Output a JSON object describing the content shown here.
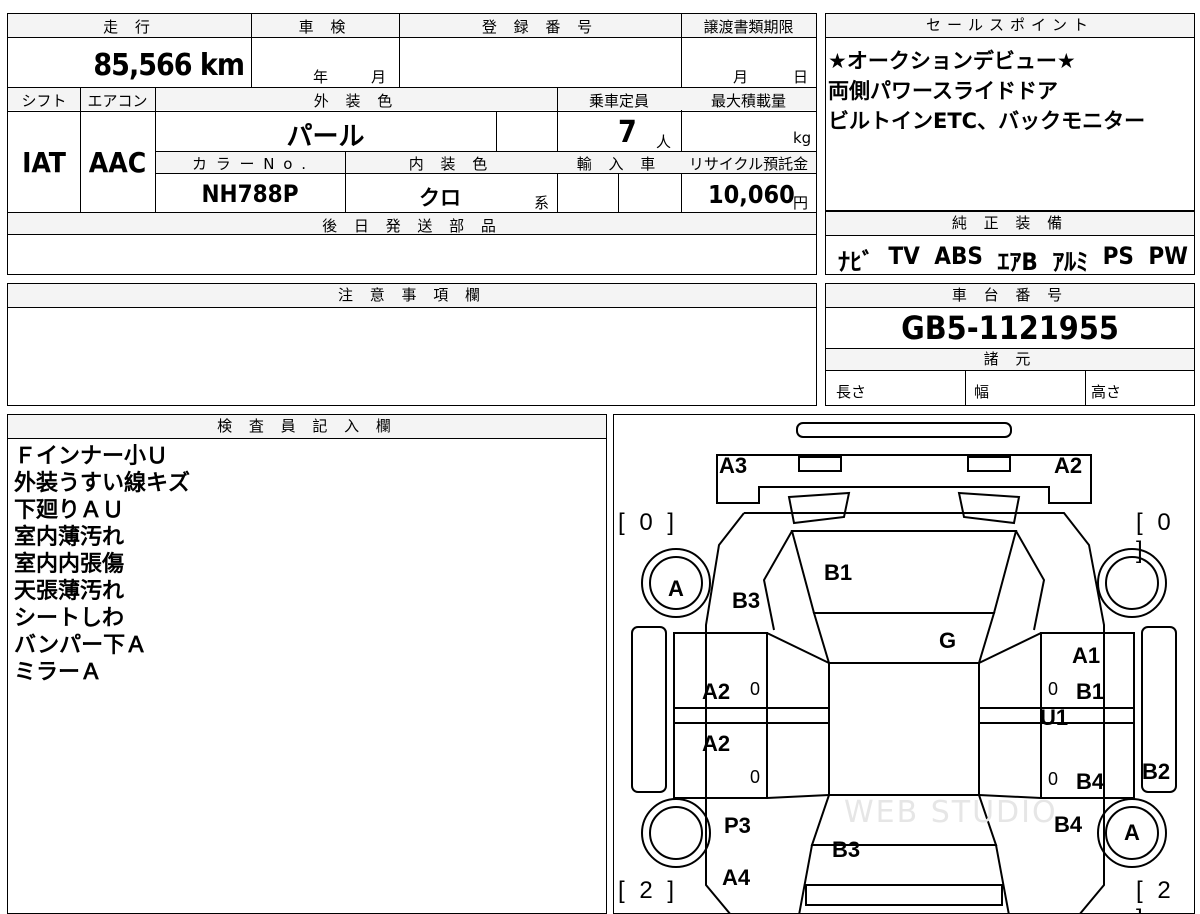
{
  "top": {
    "mileage_label": "走 行",
    "mileage": "85,566 km",
    "inspection_label": "車 検",
    "year_unit": "年",
    "month_unit": "月",
    "registration_label": "登 録 番 号",
    "transfer_label": "譲渡書類期限",
    "transfer_month": "月",
    "transfer_day": "日",
    "shift_label": "シフト",
    "shift": "IAT",
    "aircon_label": "エアコン",
    "aircon": "AAC",
    "exterior_color_label": "外 装 色",
    "exterior_color": "パール",
    "capacity_label": "乗車定員",
    "capacity": "7",
    "capacity_unit": "人",
    "max_load_label": "最大積載量",
    "max_load_unit": "kg",
    "color_no_label": "カ ラ ー N o .",
    "color_no": "NH788P",
    "interior_color_label": "内 装 色",
    "interior_color": "クロ",
    "interior_suffix": "系",
    "import_label": "輸 入 車",
    "recycle_label": "リサイクル預託金",
    "recycle_amount": "10,060",
    "recycle_unit": "円",
    "later_parts_label": "後 日 発 送 部 品"
  },
  "sales_point": {
    "label": "セールスポイント",
    "lines": [
      "★オークションデビュー★",
      "両側パワースライドドア",
      "ビルトインETC、バックモニター"
    ]
  },
  "equipment": {
    "label": "純 正 装 備",
    "items": [
      "ﾅﾋﾞ",
      "TV",
      "ABS",
      "ｴｱB",
      "ｱﾙﾐ",
      "PS",
      "PW"
    ]
  },
  "notes": {
    "label": "注 意 事 項 欄"
  },
  "chassis": {
    "label": "車 台 番 号",
    "number": "GB5-1121955",
    "specs_label": "諸 元",
    "length_label": "長さ",
    "width_label": "幅",
    "height_label": "高さ"
  },
  "inspector": {
    "label": "検 査 員 記 入 欄",
    "lines": [
      "Ｆインナー小Ｕ",
      "外装うすい線キズ",
      "下廻りＡＵ",
      "室内薄汚れ",
      "室内内張傷",
      "天張薄汚れ",
      "シートしわ",
      "バンパー下Ａ",
      "ミラーＡ"
    ]
  },
  "diagram": {
    "labels": {
      "A3": "A3",
      "A2_top": "A2",
      "B1_roof": "B1",
      "B3_top": "B3",
      "G": "G",
      "A1": "A1",
      "A2_left1": "A2",
      "A2_left2": "A2",
      "B1_right": "B1",
      "U1": "U1",
      "B4_right": "B4",
      "B2": "B2",
      "P3": "P3",
      "B4_low": "B4",
      "B3_bottom": "B3",
      "A4": "A4",
      "tire_fl": "A",
      "tire_rr": "A"
    },
    "brackets": {
      "fl": "[ 0 ]",
      "fr": "[ 0 ]",
      "rl": "[ 2 ]",
      "rr": "[ 2 ]"
    },
    "zero": "0",
    "watermark": "WEB STUDIO"
  }
}
